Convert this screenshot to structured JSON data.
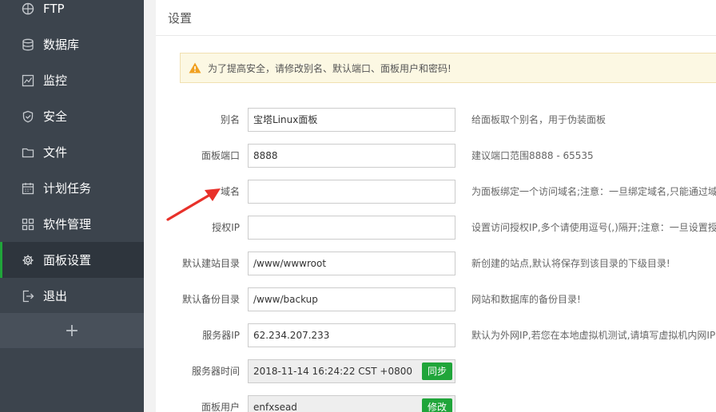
{
  "sidebar": {
    "items": [
      {
        "label": "FTP",
        "icon": "ftp-icon"
      },
      {
        "label": "数据库",
        "icon": "database-icon"
      },
      {
        "label": "监控",
        "icon": "monitor-icon"
      },
      {
        "label": "安全",
        "icon": "shield-icon"
      },
      {
        "label": "文件",
        "icon": "folder-icon"
      },
      {
        "label": "计划任务",
        "icon": "calendar-icon"
      },
      {
        "label": "软件管理",
        "icon": "grid-icon"
      },
      {
        "label": "面板设置",
        "icon": "gear-icon"
      },
      {
        "label": "退出",
        "icon": "logout-icon"
      }
    ],
    "add_label": "+"
  },
  "header": {
    "title": "设置"
  },
  "alert": {
    "text": "为了提高安全，请修改别名、默认端口、面板用户和密码!"
  },
  "form": {
    "alias": {
      "label": "别名",
      "value": "宝塔Linux面板",
      "tip": "给面板取个别名，用于伪装面板"
    },
    "port": {
      "label": "面板端口",
      "value": "8888",
      "tip": "建议端口范围8888 - 65535"
    },
    "domain": {
      "label": "域名",
      "value": "",
      "tip": "为面板绑定一个访问域名;注意：一旦绑定域名,只能通过域"
    },
    "auth_ip": {
      "label": "授权IP",
      "value": "",
      "tip": "设置访问授权IP,多个请使用逗号(,)隔开;注意：一旦设置授权"
    },
    "site_dir": {
      "label": "默认建站目录",
      "value": "/www/wwwroot",
      "tip": "新创建的站点,默认将保存到该目录的下级目录!"
    },
    "backup_dir": {
      "label": "默认备份目录",
      "value": "/www/backup",
      "tip": "网站和数据库的备份目录!"
    },
    "server_ip": {
      "label": "服务器IP",
      "value": "62.234.207.233",
      "tip": "默认为外网IP,若您在本地虚拟机测试,请填写虚拟机内网IP!"
    },
    "server_time": {
      "label": "服务器时间",
      "value": "2018-11-14 16:24:22 CST +0800",
      "button": "同步"
    },
    "panel_user": {
      "label": "面板用户",
      "value": "enfxsead",
      "button": "修改"
    }
  },
  "colors": {
    "accent": "#20a53a",
    "sidebar": "#3c444d",
    "arrow": "#e8312a"
  }
}
